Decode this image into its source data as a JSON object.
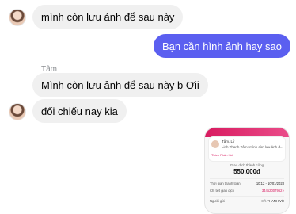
{
  "messages": [
    {
      "sender": "other",
      "text": "mình còn lưu ảnh để sau này"
    },
    {
      "sender": "me",
      "text": "Bạn cần hình ảnh hay sao"
    },
    {
      "sender": "other",
      "name": "Tâm",
      "text": "Mình còn lưu ảnh để sau này b Ơii"
    },
    {
      "sender": "other",
      "text": "đối chiếu nay kia"
    }
  ],
  "photo": {
    "card_name": "Tâm, Lý",
    "card_line": "Linh Thanh Tâm: mình còn lưu ảnh đ...",
    "card_tabs": "Thích  Phản hồi",
    "status": "Giao dịch thành công",
    "amount": "550.000đ",
    "rows": [
      {
        "label": "Thời gian thanh toán",
        "value": "10:12 - 10/01/2023"
      },
      {
        "label": "Chi tiết giao dịch",
        "value": "34452007962 ›"
      },
      {
        "label": "Người gửi",
        "value": "HÀ THANH VÕ"
      }
    ]
  },
  "colors": {
    "accent": "#5b5ff0",
    "bubble_other": "#f0f0f0"
  }
}
